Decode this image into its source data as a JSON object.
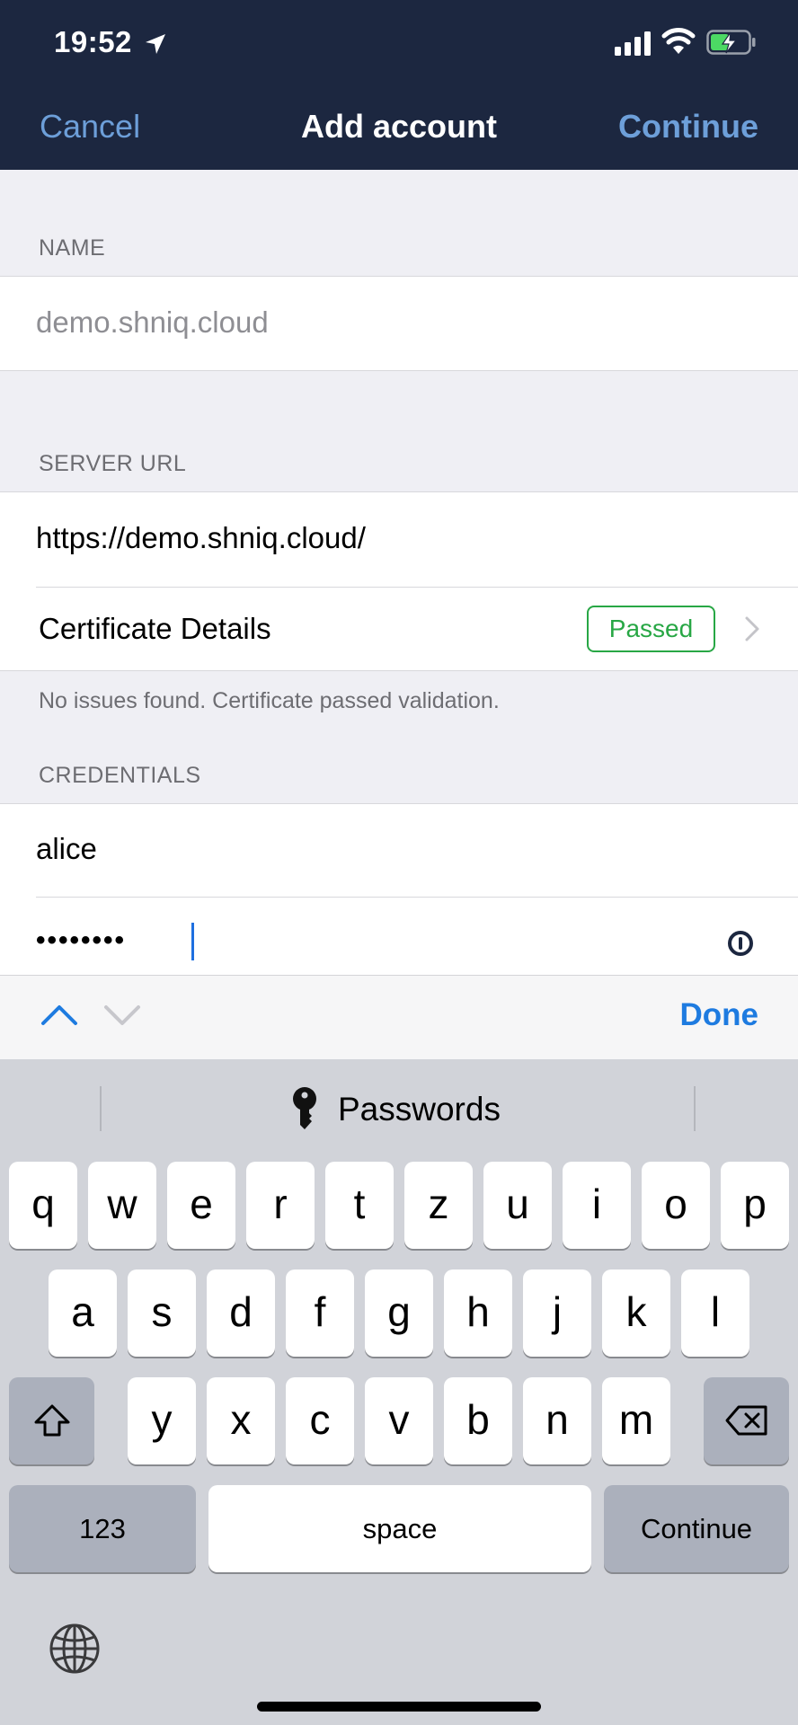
{
  "status_bar": {
    "time": "19:52"
  },
  "nav": {
    "cancel": "Cancel",
    "title": "Add account",
    "continue": "Continue"
  },
  "form": {
    "name_section": "NAME",
    "name_placeholder": "demo.shniq.cloud",
    "server_section": "SERVER URL",
    "server_url": "https://demo.shniq.cloud/",
    "cert_label": "Certificate Details",
    "cert_status": "Passed",
    "cert_note": "No issues found. Certificate passed validation.",
    "cred_section": "CREDENTIALS",
    "username": "alice",
    "password_masked": "••••••••"
  },
  "accessory_bar": {
    "done": "Done"
  },
  "keyboard": {
    "suggestion": "Passwords",
    "row1": [
      "q",
      "w",
      "e",
      "r",
      "t",
      "z",
      "u",
      "i",
      "o",
      "p"
    ],
    "row2": [
      "a",
      "s",
      "d",
      "f",
      "g",
      "h",
      "j",
      "k",
      "l"
    ],
    "row3": [
      "y",
      "x",
      "c",
      "v",
      "b",
      "n",
      "m"
    ],
    "numbers_key": "123",
    "space_key": "space",
    "return_key": "Continue"
  },
  "colors": {
    "header_bg": "#1c2740",
    "nav_link": "#6d9fd9",
    "passed_badge": "#28a745",
    "done_blue": "#1e7be0"
  }
}
